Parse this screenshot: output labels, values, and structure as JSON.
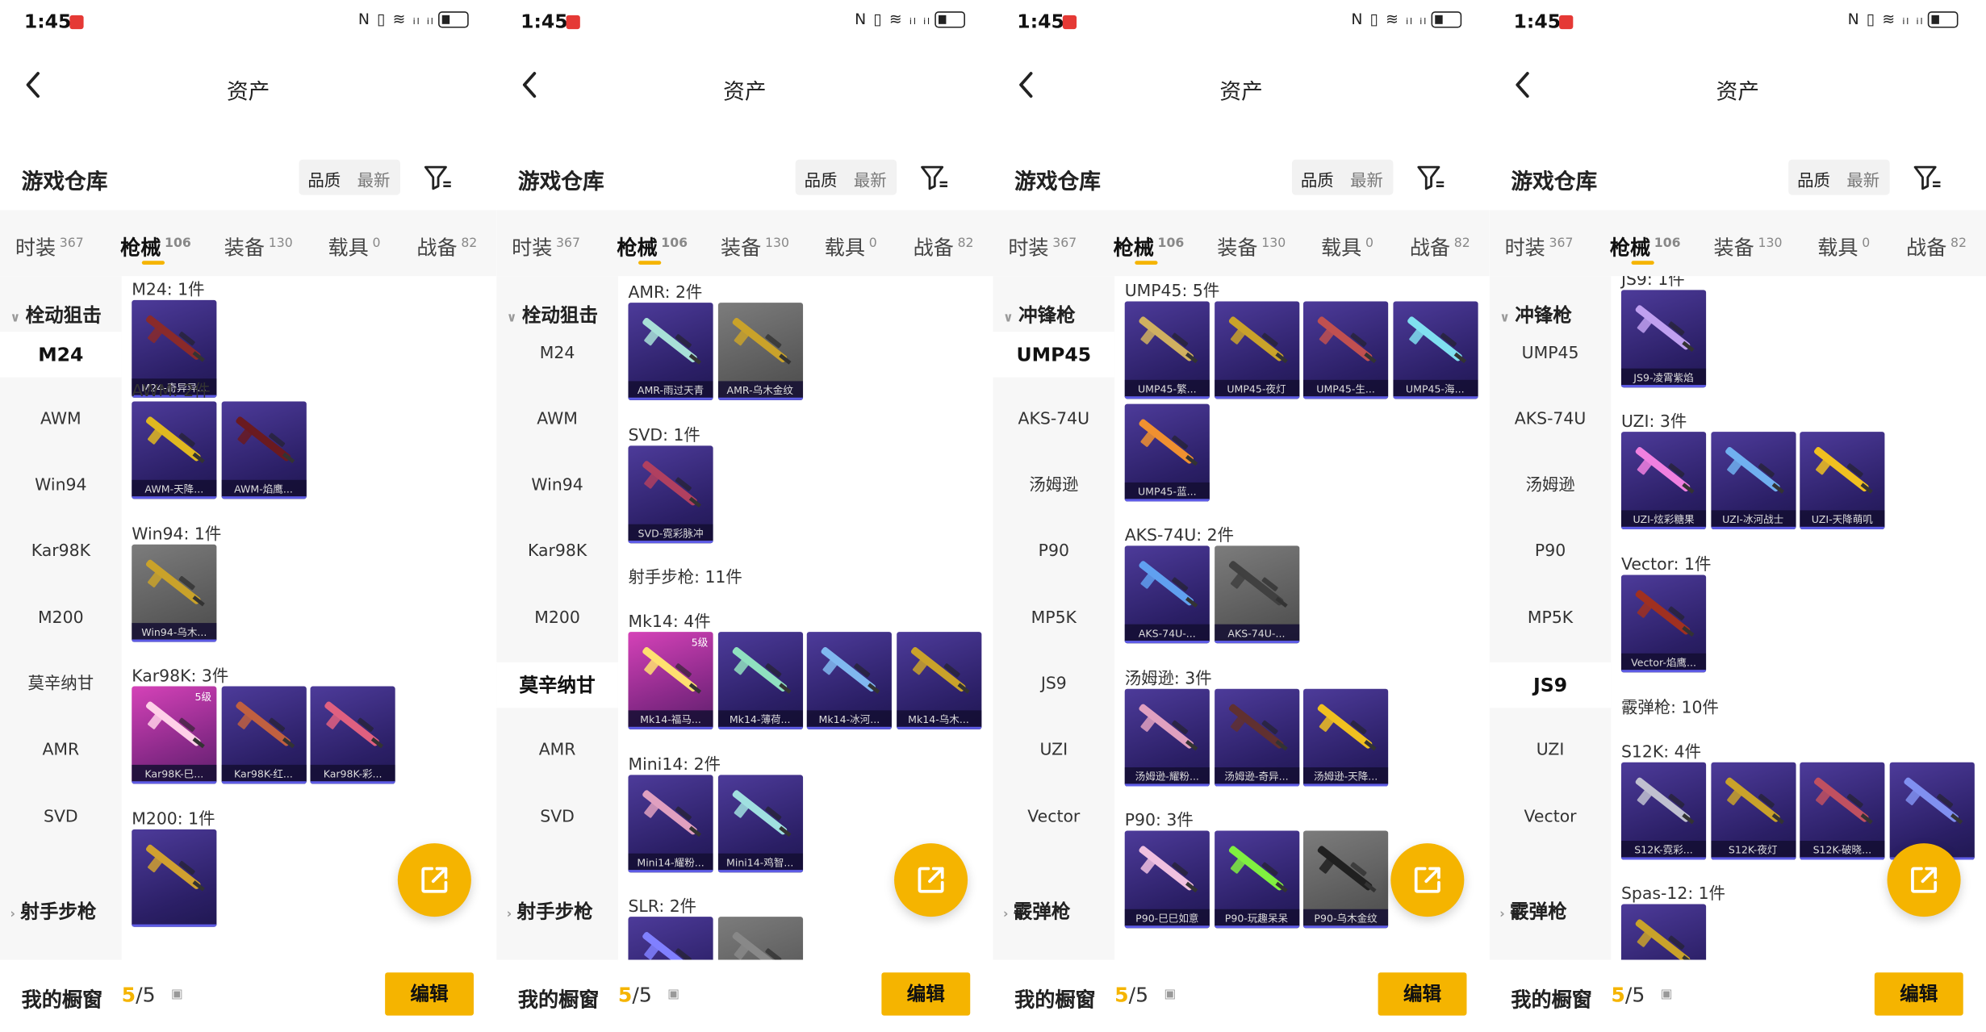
{
  "status": {
    "time": "1:45",
    "icons": "N ▯ ≋ ᵢₗ ᵢₗ"
  },
  "nav": {
    "title": "资产"
  },
  "warehouse": {
    "title": "游戏仓库",
    "sort_quality": "品质",
    "sort_newest": "最新"
  },
  "tabs": [
    {
      "label": "时装",
      "count": "367"
    },
    {
      "label": "枪械",
      "count": "106"
    },
    {
      "label": "装备",
      "count": "130"
    },
    {
      "label": "载具",
      "count": "0"
    },
    {
      "label": "战备",
      "count": "82"
    }
  ],
  "bottom": {
    "showcase_label": "我的橱窗",
    "count_current": "5",
    "count_total": "/5",
    "edit_label": "编辑"
  },
  "colors": {
    "accent": "#f5b400",
    "card_purple": "#2b1f66",
    "card_pink": "#c13fb0"
  },
  "panels": [
    {
      "side": {
        "category_top": "栓动狙击",
        "items": [
          "M24",
          "AWM",
          "Win94",
          "Kar98K",
          "M200",
          "莫辛纳甘",
          "AMR",
          "SVD"
        ],
        "selected": 0,
        "category_bottom": "射手步枪"
      },
      "sections": [
        {
          "title": "M24: 1件",
          "cards": [
            {
              "label": "M24-奇异异...",
              "style": "purple",
              "gun": "#8a2a2a"
            }
          ]
        },
        {
          "title": "AWM: 2件",
          "cards": [
            {
              "label": "AWM-天降...",
              "style": "purple",
              "gun": "#e0b820"
            },
            {
              "label": "AWM-焰鹰...",
              "style": "purple",
              "gun": "#6a1a20"
            }
          ]
        },
        {
          "title": "Win94: 1件",
          "cards": [
            {
              "label": "Win94-乌木...",
              "style": "gray",
              "gun": "#c9a22a"
            }
          ]
        },
        {
          "title": "Kar98K: 3件",
          "cards": [
            {
              "label": "Kar98K-巳...",
              "style": "pink",
              "gun": "#ffd0e8",
              "lvl": "5级"
            },
            {
              "label": "Kar98K-红...",
              "style": "purple",
              "gun": "#c06040"
            },
            {
              "label": "Kar98K-彩...",
              "style": "purple",
              "gun": "#e06080"
            }
          ]
        },
        {
          "title": "M200: 1件",
          "cards": [
            {
              "label": "",
              "style": "purple",
              "gun": "#d0a030"
            }
          ]
        }
      ]
    },
    {
      "side": {
        "category_top": "栓动狙击",
        "items": [
          "M24",
          "AWM",
          "Win94",
          "Kar98K",
          "M200",
          "莫辛纳甘",
          "AMR",
          "SVD"
        ],
        "selected": 5,
        "category_bottom": "射手步枪"
      },
      "sections": [
        {
          "title": "AMR: 2件",
          "cards": [
            {
              "label": "AMR-雨过天青",
              "style": "purple",
              "gun": "#a8e0d8"
            },
            {
              "label": "AMR-乌木金纹",
              "style": "gray",
              "gun": "#c9a22a"
            }
          ]
        },
        {
          "title": "SVD: 1件",
          "cards": [
            {
              "label": "SVD-霓彩脉冲",
              "style": "purple",
              "gun": "#b04060"
            }
          ]
        },
        {
          "title": "射手步枪: 11件",
          "cards": []
        },
        {
          "title": "Mk14: 4件",
          "cards": [
            {
              "label": "Mk14-福马...",
              "style": "pink",
              "gun": "#ffe070",
              "lvl": "5级"
            },
            {
              "label": "Mk14-薄荷...",
              "style": "purple",
              "gun": "#90e0c0"
            },
            {
              "label": "Mk14-冰河...",
              "style": "purple",
              "gun": "#80b8f0"
            },
            {
              "label": "Mk14-乌木...",
              "style": "purple",
              "gun": "#c9a22a"
            }
          ]
        },
        {
          "title": "Mini14: 2件",
          "cards": [
            {
              "label": "Mini14-耀粉...",
              "style": "purple",
              "gun": "#e0a0c0"
            },
            {
              "label": "Mini14-鸡智...",
              "style": "purple",
              "gun": "#a0e0e0"
            }
          ]
        },
        {
          "title": "SLR: 2件",
          "cards": [
            {
              "label": "",
              "style": "purple",
              "gun": "#8080ff"
            },
            {
              "label": "",
              "style": "gray",
              "gun": "#888888"
            }
          ]
        }
      ]
    },
    {
      "side": {
        "category_top": "冲锋枪",
        "items": [
          "UMP45",
          "AKS-74U",
          "汤姆逊",
          "P90",
          "MP5K",
          "JS9",
          "UZI",
          "Vector"
        ],
        "selected": 0,
        "category_bottom": "霰弹枪"
      },
      "sections": [
        {
          "title": "UMP45: 5件",
          "cards": [
            {
              "label": "UMP45-繁...",
              "style": "purple",
              "gun": "#d0b060"
            },
            {
              "label": "UMP45-夜灯",
              "style": "purple",
              "gun": "#c9a22a"
            },
            {
              "label": "UMP45-生...",
              "style": "purple",
              "gun": "#c05050"
            },
            {
              "label": "UMP45-海...",
              "style": "purple",
              "gun": "#80e0f0"
            },
            {
              "label": "UMP45-蓝...",
              "style": "purple",
              "gun": "#f09030"
            }
          ]
        },
        {
          "title": "AKS-74U: 2件",
          "cards": [
            {
              "label": "AKS-74U-...",
              "style": "purple",
              "gun": "#60a0f0"
            },
            {
              "label": "AKS-74U-...",
              "style": "gray",
              "gun": "#404040"
            }
          ]
        },
        {
          "title": "汤姆逊: 3件",
          "cards": [
            {
              "label": "汤姆逊-耀粉...",
              "style": "purple",
              "gun": "#e0a0c0"
            },
            {
              "label": "汤姆逊-奇异...",
              "style": "purple",
              "gun": "#603030"
            },
            {
              "label": "汤姆逊-天降...",
              "style": "purple",
              "gun": "#f0c020"
            }
          ]
        },
        {
          "title": "P90: 3件",
          "cards": [
            {
              "label": "P90-巳巳如意",
              "style": "purple",
              "gun": "#f0c0e0"
            },
            {
              "label": "P90-玩趣呆呆",
              "style": "purple",
              "gun": "#80f040"
            },
            {
              "label": "P90-乌木金纹",
              "style": "gray",
              "gun": "#202020"
            }
          ]
        }
      ]
    },
    {
      "side": {
        "category_top": "冲锋枪",
        "items": [
          "UMP45",
          "AKS-74U",
          "汤姆逊",
          "P90",
          "MP5K",
          "JS9",
          "UZI",
          "Vector"
        ],
        "selected": 5,
        "category_bottom": "霰弹枪"
      },
      "sections": [
        {
          "title": "JS9: 1件",
          "cards": [
            {
              "label": "JS9-凌霄紫焰",
              "style": "purple",
              "gun": "#c0a0f0"
            }
          ]
        },
        {
          "title": "UZI: 3件",
          "cards": [
            {
              "label": "UZI-炫彩糖果",
              "style": "purple",
              "gun": "#f080e0"
            },
            {
              "label": "UZI-冰河战士",
              "style": "purple",
              "gun": "#70b0f0"
            },
            {
              "label": "UZI-天降萌叽",
              "style": "purple",
              "gun": "#f0c020"
            }
          ]
        },
        {
          "title": "Vector: 1件",
          "cards": [
            {
              "label": "Vector-焰鹰...",
              "style": "purple",
              "gun": "#a03020"
            }
          ]
        },
        {
          "title": "霰弹枪: 10件",
          "cards": []
        },
        {
          "title": "S12K: 4件",
          "cards": [
            {
              "label": "S12K-霓彩...",
              "style": "purple",
              "gun": "#c0c0d0"
            },
            {
              "label": "S12K-夜灯",
              "style": "purple",
              "gun": "#c9a22a"
            },
            {
              "label": "S12K-破晓...",
              "style": "purple",
              "gun": "#c05060"
            },
            {
              "label": "",
              "style": "purple",
              "gun": "#8090f0"
            }
          ]
        },
        {
          "title": "Spas-12: 1件",
          "cards": [
            {
              "label": "",
              "style": "purple",
              "gun": "#c9a22a"
            }
          ]
        }
      ]
    }
  ]
}
